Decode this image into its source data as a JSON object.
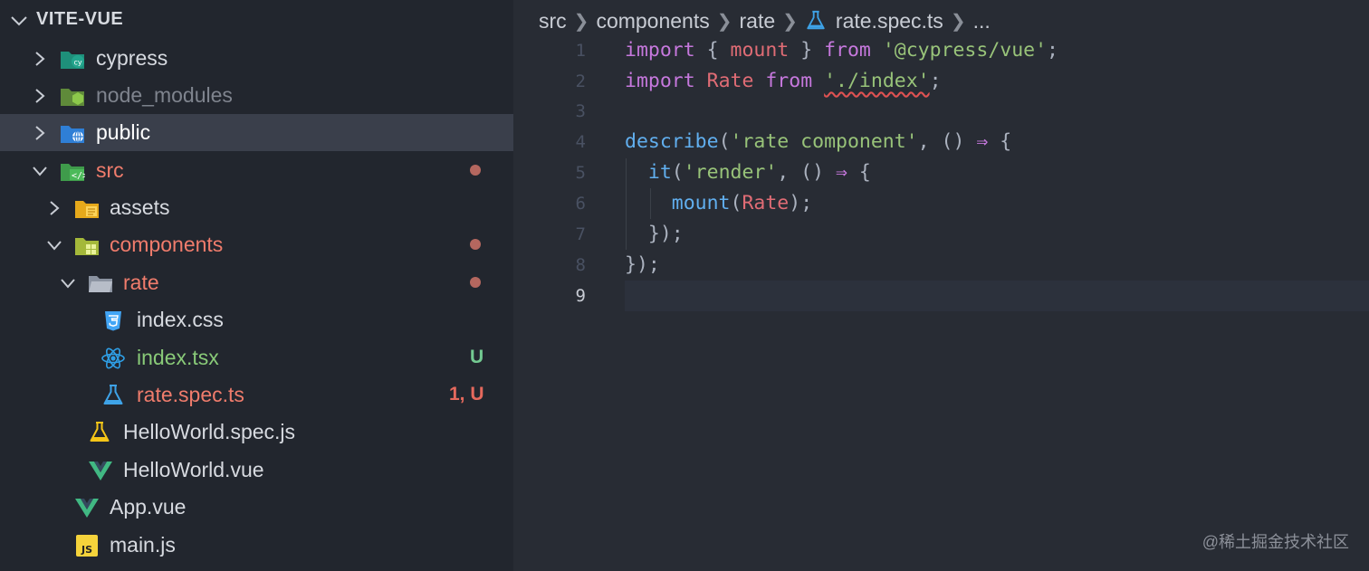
{
  "explorer": {
    "title": "VITE-VUE",
    "items": [
      {
        "label": "cypress",
        "state": "collapsed"
      },
      {
        "label": "node_modules",
        "state": "collapsed"
      },
      {
        "label": "public",
        "state": "collapsed"
      },
      {
        "label": "src",
        "state": "expanded"
      },
      {
        "label": "assets",
        "state": "collapsed"
      },
      {
        "label": "components",
        "state": "expanded"
      },
      {
        "label": "rate",
        "state": "expanded"
      },
      {
        "label": "index.css"
      },
      {
        "label": "index.tsx",
        "badge": "U"
      },
      {
        "label": "rate.spec.ts",
        "badge": "1, U"
      },
      {
        "label": "HelloWorld.spec.js"
      },
      {
        "label": "HelloWorld.vue"
      },
      {
        "label": "App.vue"
      },
      {
        "label": "main.js"
      }
    ]
  },
  "breadcrumb": [
    "src",
    "components",
    "rate",
    "rate.spec.ts",
    "..."
  ],
  "editor": {
    "line_numbers": [
      "1",
      "2",
      "3",
      "4",
      "5",
      "6",
      "7",
      "8",
      "9"
    ],
    "current_line": 9,
    "code": {
      "l1": {
        "a": "import",
        "b": " { ",
        "c": "mount",
        "d": " } ",
        "e": "from",
        "f": " ",
        "g": "'@cypress/vue'",
        "h": ";"
      },
      "l2": {
        "a": "import",
        "b": " ",
        "c": "Rate",
        "d": " ",
        "e": "from",
        "f": " ",
        "g": "'./index'",
        "h": ";"
      },
      "l4": {
        "a": "describe",
        "b": "(",
        "c": "'rate component'",
        "d": ", () ",
        "e": "⇒",
        "f": " {"
      },
      "l5": {
        "a": "it",
        "b": "(",
        "c": "'render'",
        "d": ", () ",
        "e": "⇒",
        "f": " {"
      },
      "l6": {
        "a": "mount",
        "b": "(",
        "c": "Rate",
        "d": ");"
      },
      "l7": {
        "a": "});"
      },
      "l8": {
        "a": "});"
      }
    }
  },
  "watermark": "@稀土掘金技术社区",
  "colors": {
    "sidebar_bg": "#22262e",
    "editor_bg": "#282c34",
    "selected_row": "#3a3f4b",
    "modified": "#f07c6c",
    "untracked": "#89ca78",
    "keyword": "#c678dd",
    "function": "#61afef",
    "string": "#98c379",
    "variable": "#e06c75"
  }
}
